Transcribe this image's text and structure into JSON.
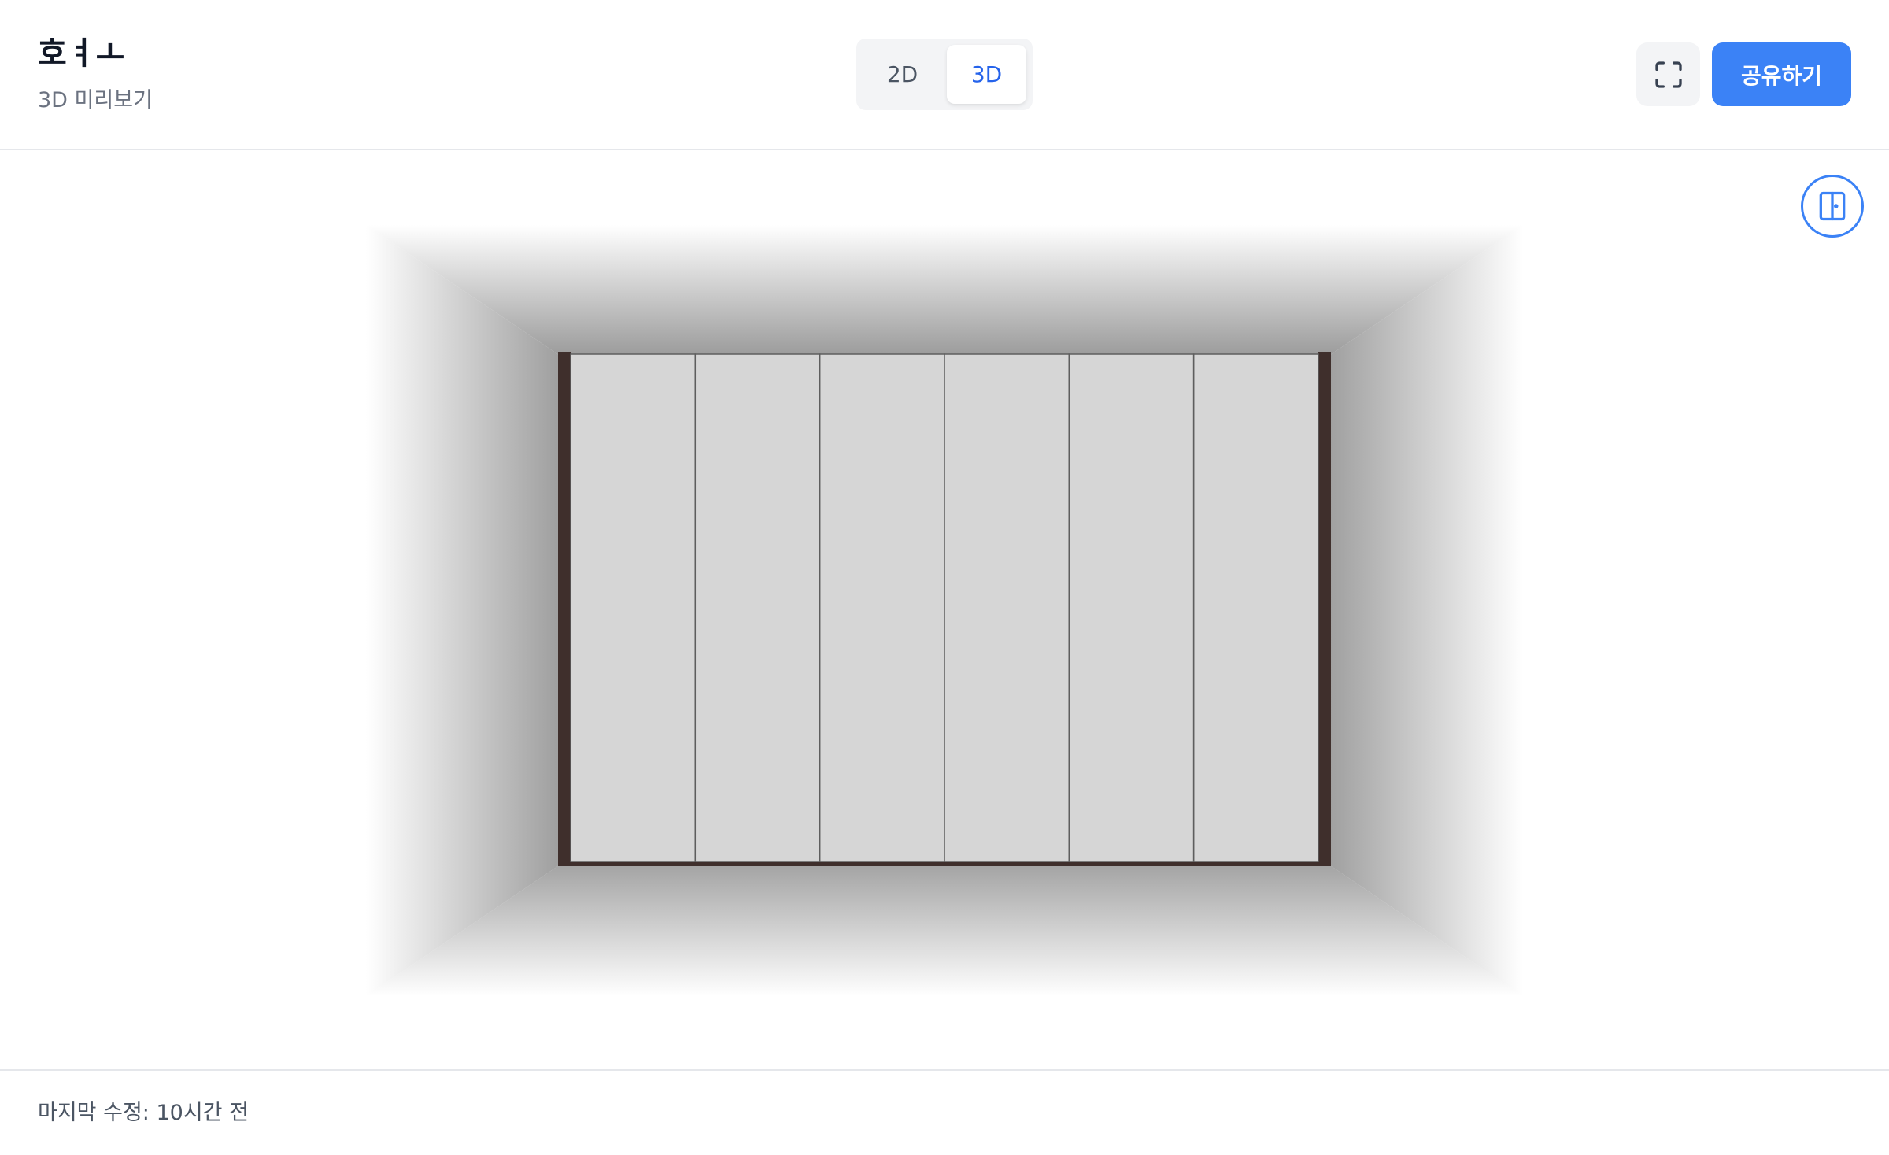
{
  "header": {
    "title": "호ㅕㅗ",
    "subtitle": "3D 미리보기"
  },
  "view_toggle": {
    "options": [
      {
        "label": "2D",
        "active": false
      },
      {
        "label": "3D",
        "active": true
      }
    ]
  },
  "actions": {
    "fullscreen_icon": "fullscreen-icon",
    "share_label": "공유하기"
  },
  "viewport": {
    "door_toggle_icon": "door-panel-icon",
    "wardrobe": {
      "door_count": 6,
      "frame_color": "#3f2f2c",
      "door_color": "#d6d6d6"
    }
  },
  "footer": {
    "last_modified": "마지막 수정: 10시간 전"
  },
  "colors": {
    "accent": "#3b82f6",
    "accent_text": "#2563eb"
  }
}
